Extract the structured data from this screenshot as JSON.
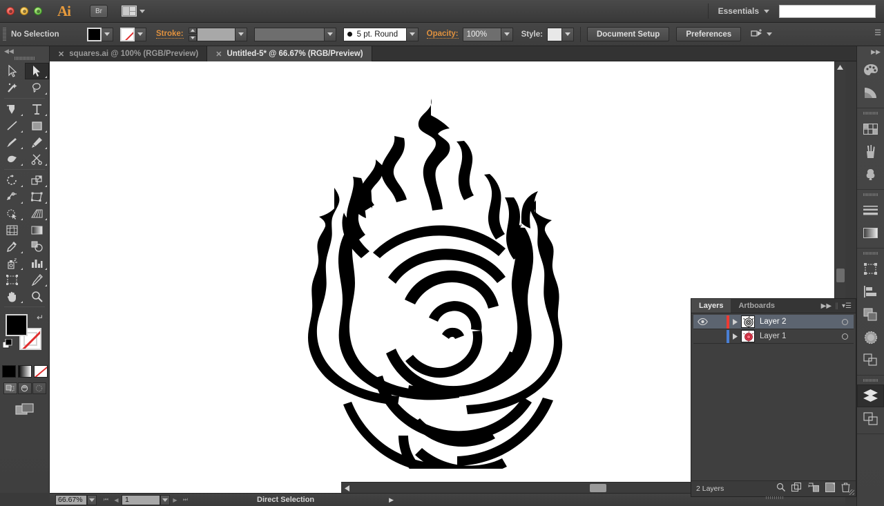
{
  "titlebar": {
    "app_logo": "Ai",
    "bridge_label": "Br",
    "arrange_icon": "arrange-documents-icon",
    "workspace": "Essentials",
    "search_value": ""
  },
  "controlbar": {
    "selection_status": "No Selection",
    "fill_swatch": "#000000",
    "stroke_swatch": "none",
    "stroke_label": "Stroke:",
    "stroke_weight": "",
    "width_profile": "",
    "brush_definition": "5 pt. Round",
    "opacity_label": "Opacity:",
    "opacity_value": "100%",
    "style_label": "Style:",
    "document_setup": "Document Setup",
    "preferences": "Preferences"
  },
  "tabs": [
    {
      "label": "squares.ai @ 100% (RGB/Preview)",
      "active": false
    },
    {
      "label": "Untitled-5* @ 66.67% (RGB/Preview)",
      "active": true
    }
  ],
  "toolbar": {
    "tools": [
      "selection-tool",
      "direct-selection-tool",
      "magic-wand-tool",
      "lasso-tool",
      "pen-tool",
      "type-tool",
      "line-segment-tool",
      "rectangle-tool",
      "paintbrush-tool",
      "pencil-tool",
      "blob-brush-tool",
      "scissors-tool",
      "rotate-tool",
      "scale-tool",
      "width-tool",
      "free-transform-tool",
      "shape-builder-tool",
      "perspective-grid-tool",
      "mesh-tool",
      "gradient-tool",
      "eyedropper-tool",
      "blend-tool",
      "symbol-sprayer-tool",
      "column-graph-tool",
      "artboard-tool",
      "slice-tool",
      "hand-tool",
      "zoom-tool"
    ],
    "active_tool": "direct-selection-tool",
    "fill_color": "#000000",
    "stroke_color": "none",
    "color_modes": [
      "color-button",
      "gradient-button",
      "none-button"
    ],
    "draw_modes": [
      "draw-normal",
      "draw-behind",
      "draw-inside"
    ],
    "screen_mode": "change-screen-mode"
  },
  "statusbar": {
    "zoom_level": "66.67%",
    "artboard_number": "1",
    "status_text": "Direct Selection"
  },
  "rightdock": {
    "items": [
      "color-panel-icon",
      "color-guide-panel-icon",
      "swatches-panel-icon",
      "brushes-panel-icon",
      "symbols-panel-icon",
      "stroke-panel-icon",
      "gradient-panel-icon",
      "transform-panel-icon",
      "align-panel-icon",
      "pathfinder-panel-icon",
      "transparency-panel-icon",
      "appearance-panel-icon",
      "layers-panel-icon",
      "artboards-panel-icon"
    ],
    "active": "layers-panel-icon"
  },
  "layers_panel": {
    "tabs": [
      {
        "label": "Layers",
        "active": true
      },
      {
        "label": "Artboards",
        "active": false
      }
    ],
    "collapse_icon": "double-chevron-right-icon",
    "menu_icon": "panel-menu-icon",
    "rows": [
      {
        "name": "Layer 2",
        "color": "#ee3b33",
        "visible": true,
        "selected": true,
        "thumb": "rose-outline-thumbnail"
      },
      {
        "name": "Layer 1",
        "color": "#4a7fd4",
        "visible": false,
        "selected": false,
        "thumb": "rose-red-thumbnail"
      }
    ],
    "footer_count": "2 Layers",
    "footer_icons": [
      "locate-object-icon",
      "make-clipping-mask-icon",
      "create-new-sublayer-icon",
      "create-new-layer-icon",
      "delete-selection-icon"
    ]
  },
  "canvas": {
    "artwork_name": "rose-flame-emblem",
    "artwork_fill": "#000000",
    "background": "#ffffff"
  },
  "scrollbars": {
    "vertical": "vertical-scrollbar",
    "horizontal": "horizontal-scrollbar"
  }
}
